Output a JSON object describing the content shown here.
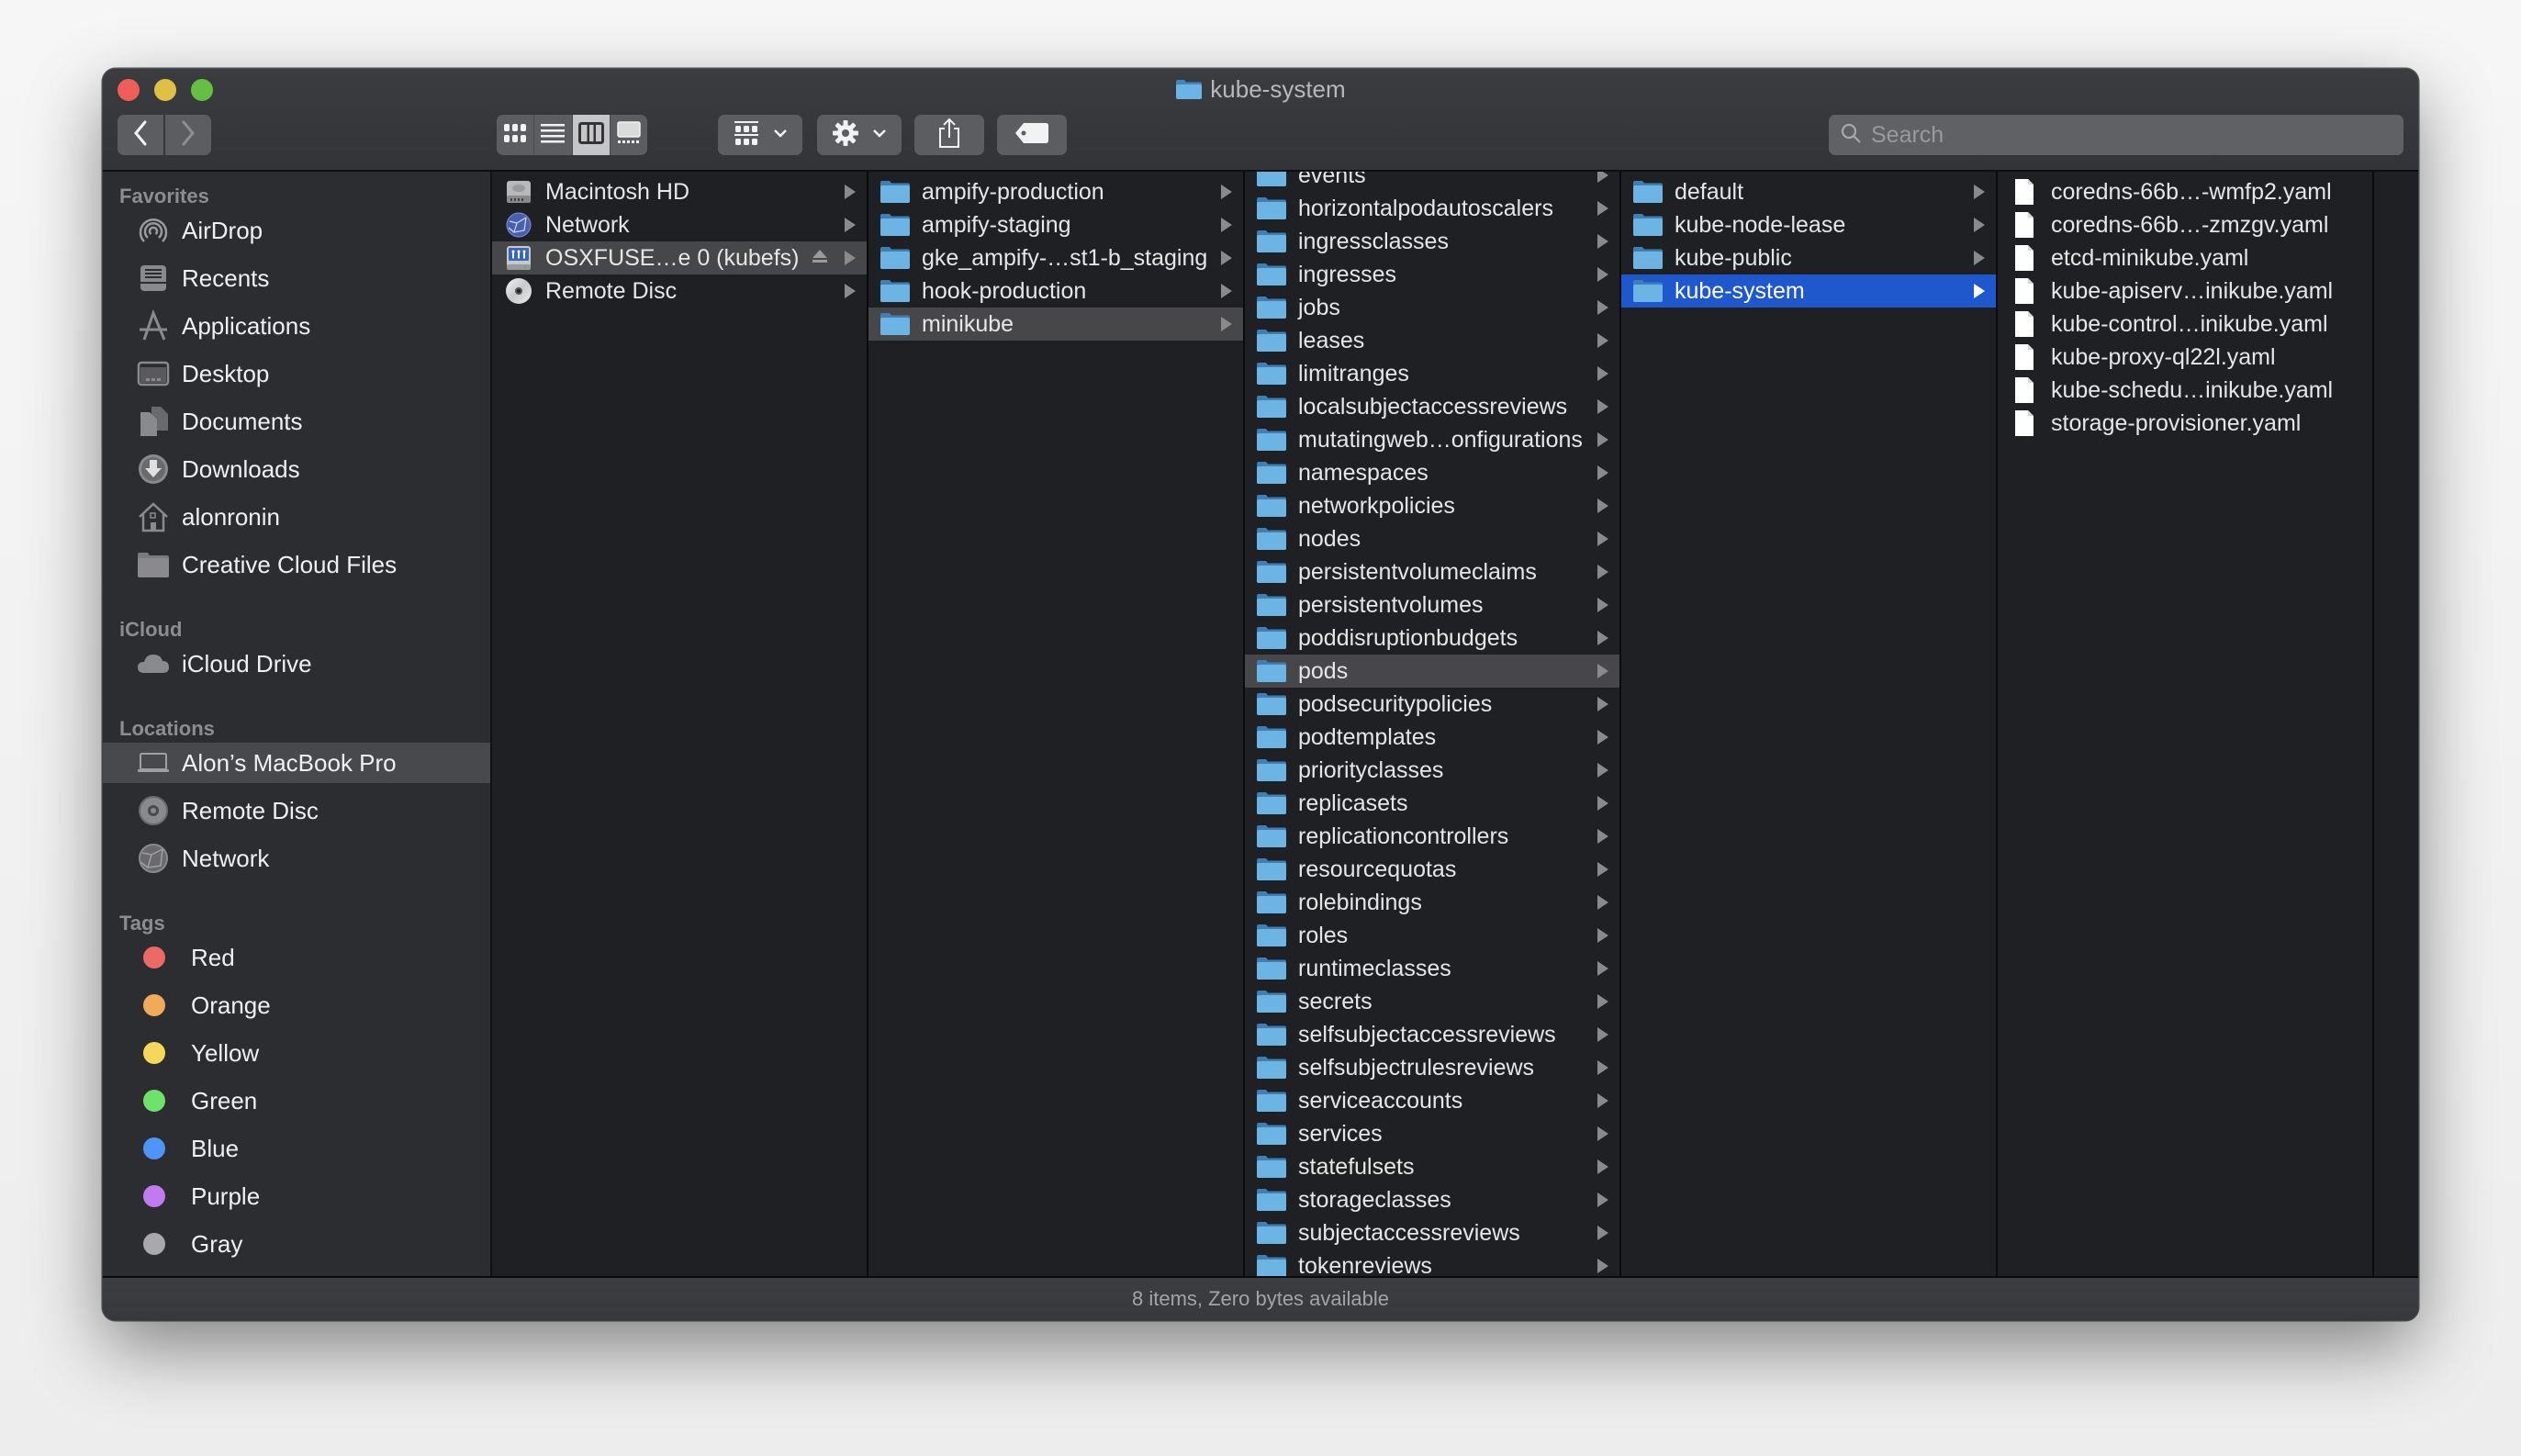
{
  "window": {
    "title": "kube-system",
    "title_icon": "folder-icon",
    "traffic_lights": {
      "close": "#ee5f58",
      "minimize": "#e0bf45",
      "maximize": "#63c043"
    }
  },
  "toolbar": {
    "back_icon": "chevron-left-icon",
    "forward_icon": "chevron-right-icon",
    "view_modes": [
      {
        "name": "icon-view",
        "icon": "grid-icon",
        "active": false
      },
      {
        "name": "list-view",
        "icon": "list-icon",
        "active": false
      },
      {
        "name": "column-view",
        "icon": "columns-icon",
        "active": true
      },
      {
        "name": "gallery-view",
        "icon": "gallery-icon",
        "active": false
      }
    ],
    "group_icon": "group-icon",
    "action_icon": "gear-icon",
    "share_icon": "share-icon",
    "tag_icon": "tag-icon",
    "search": {
      "placeholder": "Search",
      "value": ""
    }
  },
  "sidebar": {
    "favorites_label": "Favorites",
    "favorites": [
      {
        "label": "AirDrop",
        "icon": "airdrop-icon"
      },
      {
        "label": "Recents",
        "icon": "recents-icon"
      },
      {
        "label": "Applications",
        "icon": "applications-icon"
      },
      {
        "label": "Desktop",
        "icon": "desktop-icon"
      },
      {
        "label": "Documents",
        "icon": "documents-icon"
      },
      {
        "label": "Downloads",
        "icon": "downloads-icon"
      },
      {
        "label": "alonronin",
        "icon": "home-icon"
      },
      {
        "label": "Creative Cloud Files",
        "icon": "folder-icon"
      }
    ],
    "icloud_label": "iCloud",
    "icloud": [
      {
        "label": "iCloud Drive",
        "icon": "cloud-icon"
      }
    ],
    "locations_label": "Locations",
    "locations": [
      {
        "label": "Alon’s MacBook Pro",
        "icon": "laptop-icon",
        "selected": true
      },
      {
        "label": "Remote Disc",
        "icon": "disc-icon"
      },
      {
        "label": "Network",
        "icon": "network-icon"
      }
    ],
    "tags_label": "Tags",
    "tags": [
      {
        "label": "Red",
        "color": "#ec6a65"
      },
      {
        "label": "Orange",
        "color": "#f1a95a"
      },
      {
        "label": "Yellow",
        "color": "#f5d85a"
      },
      {
        "label": "Green",
        "color": "#6ee26a"
      },
      {
        "label": "Blue",
        "color": "#4f94f8"
      },
      {
        "label": "Purple",
        "color": "#c27af0"
      },
      {
        "label": "Gray",
        "color": "#a9a9ad"
      }
    ]
  },
  "columns": [
    {
      "name": "computer",
      "items": [
        {
          "label": "Macintosh HD",
          "icon": "hard-drive-icon",
          "has_children": true
        },
        {
          "label": "Network",
          "icon": "network-globe-icon",
          "has_children": true
        },
        {
          "label": "OSXFUSE…e 0 (kubefs)",
          "icon": "fuse-volume-icon",
          "has_children": true,
          "ejectable": true,
          "selected": "gray"
        },
        {
          "label": "Remote Disc",
          "icon": "cd-icon",
          "has_children": true
        }
      ]
    },
    {
      "name": "kubefs",
      "items": [
        {
          "label": "ampify-production",
          "icon": "folder-icon",
          "has_children": true
        },
        {
          "label": "ampify-staging",
          "icon": "folder-icon",
          "has_children": true
        },
        {
          "label": "gke_ampify-…st1-b_staging",
          "icon": "folder-icon",
          "has_children": true
        },
        {
          "label": "hook-production",
          "icon": "folder-icon",
          "has_children": true
        },
        {
          "label": "minikube",
          "icon": "folder-icon",
          "has_children": true,
          "selected": "gray"
        }
      ]
    },
    {
      "name": "minikube",
      "items": [
        {
          "label": "events",
          "icon": "folder-icon",
          "has_children": true
        },
        {
          "label": "horizontalpodautoscalers",
          "icon": "folder-icon",
          "has_children": true
        },
        {
          "label": "ingressclasses",
          "icon": "folder-icon",
          "has_children": true
        },
        {
          "label": "ingresses",
          "icon": "folder-icon",
          "has_children": true
        },
        {
          "label": "jobs",
          "icon": "folder-icon",
          "has_children": true
        },
        {
          "label": "leases",
          "icon": "folder-icon",
          "has_children": true
        },
        {
          "label": "limitranges",
          "icon": "folder-icon",
          "has_children": true
        },
        {
          "label": "localsubjectaccessreviews",
          "icon": "folder-icon",
          "has_children": true
        },
        {
          "label": "mutatingweb…onfigurations",
          "icon": "folder-icon",
          "has_children": true
        },
        {
          "label": "namespaces",
          "icon": "folder-icon",
          "has_children": true
        },
        {
          "label": "networkpolicies",
          "icon": "folder-icon",
          "has_children": true
        },
        {
          "label": "nodes",
          "icon": "folder-icon",
          "has_children": true
        },
        {
          "label": "persistentvolumeclaims",
          "icon": "folder-icon",
          "has_children": true
        },
        {
          "label": "persistentvolumes",
          "icon": "folder-icon",
          "has_children": true
        },
        {
          "label": "poddisruptionbudgets",
          "icon": "folder-icon",
          "has_children": true
        },
        {
          "label": "pods",
          "icon": "folder-icon",
          "has_children": true,
          "selected": "gray"
        },
        {
          "label": "podsecuritypolicies",
          "icon": "folder-icon",
          "has_children": true
        },
        {
          "label": "podtemplates",
          "icon": "folder-icon",
          "has_children": true
        },
        {
          "label": "priorityclasses",
          "icon": "folder-icon",
          "has_children": true
        },
        {
          "label": "replicasets",
          "icon": "folder-icon",
          "has_children": true
        },
        {
          "label": "replicationcontrollers",
          "icon": "folder-icon",
          "has_children": true
        },
        {
          "label": "resourcequotas",
          "icon": "folder-icon",
          "has_children": true
        },
        {
          "label": "rolebindings",
          "icon": "folder-icon",
          "has_children": true
        },
        {
          "label": "roles",
          "icon": "folder-icon",
          "has_children": true
        },
        {
          "label": "runtimeclasses",
          "icon": "folder-icon",
          "has_children": true
        },
        {
          "label": "secrets",
          "icon": "folder-icon",
          "has_children": true
        },
        {
          "label": "selfsubjectaccessreviews",
          "icon": "folder-icon",
          "has_children": true
        },
        {
          "label": "selfsubjectrulesreviews",
          "icon": "folder-icon",
          "has_children": true
        },
        {
          "label": "serviceaccounts",
          "icon": "folder-icon",
          "has_children": true
        },
        {
          "label": "services",
          "icon": "folder-icon",
          "has_children": true
        },
        {
          "label": "statefulsets",
          "icon": "folder-icon",
          "has_children": true
        },
        {
          "label": "storageclasses",
          "icon": "folder-icon",
          "has_children": true
        },
        {
          "label": "subjectaccessreviews",
          "icon": "folder-icon",
          "has_children": true
        },
        {
          "label": "tokenreviews",
          "icon": "folder-icon",
          "has_children": true
        }
      ]
    },
    {
      "name": "pods",
      "items": [
        {
          "label": "default",
          "icon": "folder-icon",
          "has_children": true
        },
        {
          "label": "kube-node-lease",
          "icon": "folder-icon",
          "has_children": true
        },
        {
          "label": "kube-public",
          "icon": "folder-icon",
          "has_children": true
        },
        {
          "label": "kube-system",
          "icon": "folder-icon",
          "has_children": true,
          "selected": "blue"
        }
      ]
    },
    {
      "name": "kube-system",
      "items": [
        {
          "label": "coredns-66b…-wmfp2.yaml",
          "icon": "document-icon"
        },
        {
          "label": "coredns-66b…-zmzgv.yaml",
          "icon": "document-icon"
        },
        {
          "label": "etcd-minikube.yaml",
          "icon": "document-icon"
        },
        {
          "label": "kube-apiserv…inikube.yaml",
          "icon": "document-icon"
        },
        {
          "label": "kube-control…inikube.yaml",
          "icon": "document-icon"
        },
        {
          "label": "kube-proxy-ql22l.yaml",
          "icon": "document-icon"
        },
        {
          "label": "kube-schedu…inikube.yaml",
          "icon": "document-icon"
        },
        {
          "label": "storage-provisioner.yaml",
          "icon": "document-icon"
        }
      ]
    }
  ],
  "status_bar": {
    "text": "8 items, Zero bytes available"
  },
  "colors": {
    "selection_blue": "#1f58cc",
    "folder_blue": "#6cb4e4"
  }
}
